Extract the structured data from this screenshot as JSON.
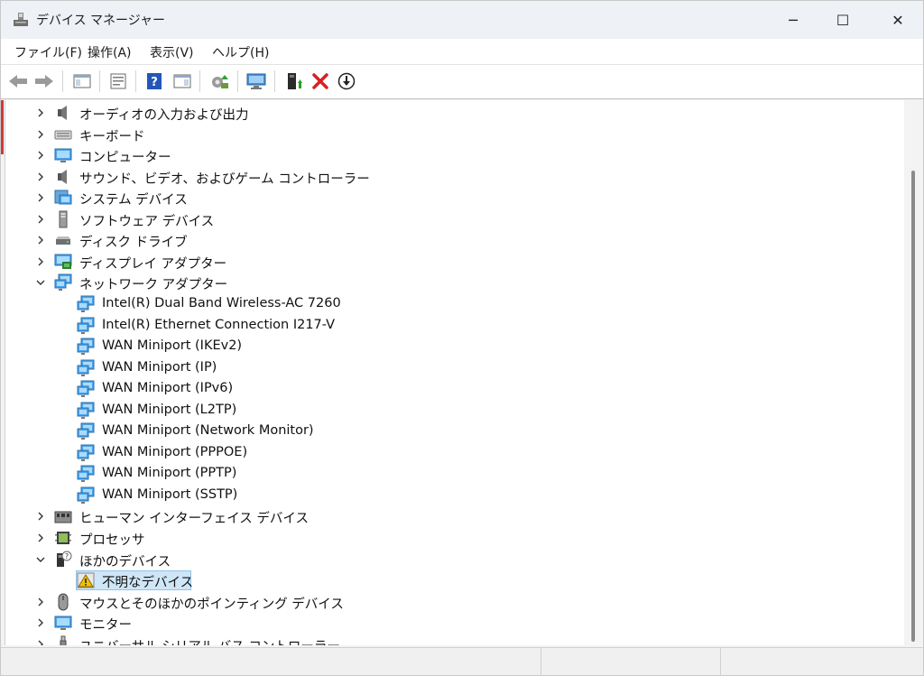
{
  "window": {
    "title": "デバイス マネージャー",
    "icon": "device-manager-icon",
    "controls": {
      "minimize": "─",
      "maximize": "☐",
      "close": "✕"
    }
  },
  "menu": [
    "ファイル(F)",
    "操作(A)",
    "表示(V)",
    "ヘルプ(H)"
  ],
  "toolbar": {
    "icons": [
      "back-arrow-icon",
      "forward-arrow-icon",
      "show-hide-console-tree-icon",
      "properties-icon",
      "help-icon",
      "show-action-pane-icon",
      "update-driver-icon",
      "scan-hardware-icon",
      "enable-device-icon",
      "uninstall-device-icon",
      "download-icon"
    ]
  },
  "tree": {
    "rows": [
      {
        "label": "オーディオの入力および出力",
        "expanded": false,
        "level": 0,
        "icon": "speaker-icon"
      },
      {
        "label": "キーボード",
        "expanded": false,
        "level": 0,
        "icon": "keyboard-icon"
      },
      {
        "label": "コンピューター",
        "expanded": false,
        "level": 0,
        "icon": "monitor-icon"
      },
      {
        "label": "サウンド、ビデオ、およびゲーム コントローラー",
        "expanded": false,
        "level": 0,
        "icon": "speaker-icon"
      },
      {
        "label": "システム デバイス",
        "expanded": false,
        "level": 0,
        "icon": "folder-monitor-icon"
      },
      {
        "label": "ソフトウェア デバイス",
        "expanded": false,
        "level": 0,
        "icon": "tower-icon"
      },
      {
        "label": "ディスク ドライブ",
        "expanded": false,
        "level": 0,
        "icon": "disk-drive-icon"
      },
      {
        "label": "ディスプレイ アダプター",
        "expanded": false,
        "level": 0,
        "icon": "display-adapter-icon"
      },
      {
        "label": "ネットワーク アダプター",
        "expanded": true,
        "level": 0,
        "icon": "network-icon"
      },
      {
        "label": "Intel(R) Dual Band Wireless-AC 7260",
        "level": 1,
        "icon": "network-icon"
      },
      {
        "label": "Intel(R) Ethernet Connection I217-V",
        "level": 1,
        "icon": "network-icon"
      },
      {
        "label": "WAN Miniport (IKEv2)",
        "level": 1,
        "icon": "network-icon"
      },
      {
        "label": "WAN Miniport (IP)",
        "level": 1,
        "icon": "network-icon"
      },
      {
        "label": "WAN Miniport (IPv6)",
        "level": 1,
        "icon": "network-icon"
      },
      {
        "label": "WAN Miniport (L2TP)",
        "level": 1,
        "icon": "network-icon"
      },
      {
        "label": "WAN Miniport (Network Monitor)",
        "level": 1,
        "icon": "network-icon"
      },
      {
        "label": "WAN Miniport (PPPOE)",
        "level": 1,
        "icon": "network-icon"
      },
      {
        "label": "WAN Miniport (PPTP)",
        "level": 1,
        "icon": "network-icon"
      },
      {
        "label": "WAN Miniport (SSTP)",
        "level": 1,
        "icon": "network-icon"
      },
      {
        "label": "ヒューマン インターフェイス デバイス",
        "expanded": false,
        "level": 0,
        "icon": "hid-icon"
      },
      {
        "label": "プロセッサ",
        "expanded": false,
        "level": 0,
        "icon": "processor-icon"
      },
      {
        "label": "ほかのデバイス",
        "expanded": true,
        "level": 0,
        "icon": "unknown-device-icon"
      },
      {
        "label": "不明なデバイス",
        "level": 1,
        "icon": "warning-device-icon",
        "selected": true
      },
      {
        "label": "マウスとそのほかのポインティング デバイス",
        "expanded": false,
        "level": 0,
        "icon": "mouse-icon"
      },
      {
        "label": "モニター",
        "expanded": false,
        "level": 0,
        "icon": "monitor-icon"
      },
      {
        "label": "ユニバーサル シリアル バス コントローラー",
        "expanded": false,
        "level": 0,
        "icon": "usb-icon"
      }
    ]
  },
  "colors": {
    "accent": "#2a7fd6",
    "selection": "#cfe6f7",
    "warning": "#f2c200",
    "delete": "#d92020",
    "enable": "#2a9d2a"
  }
}
